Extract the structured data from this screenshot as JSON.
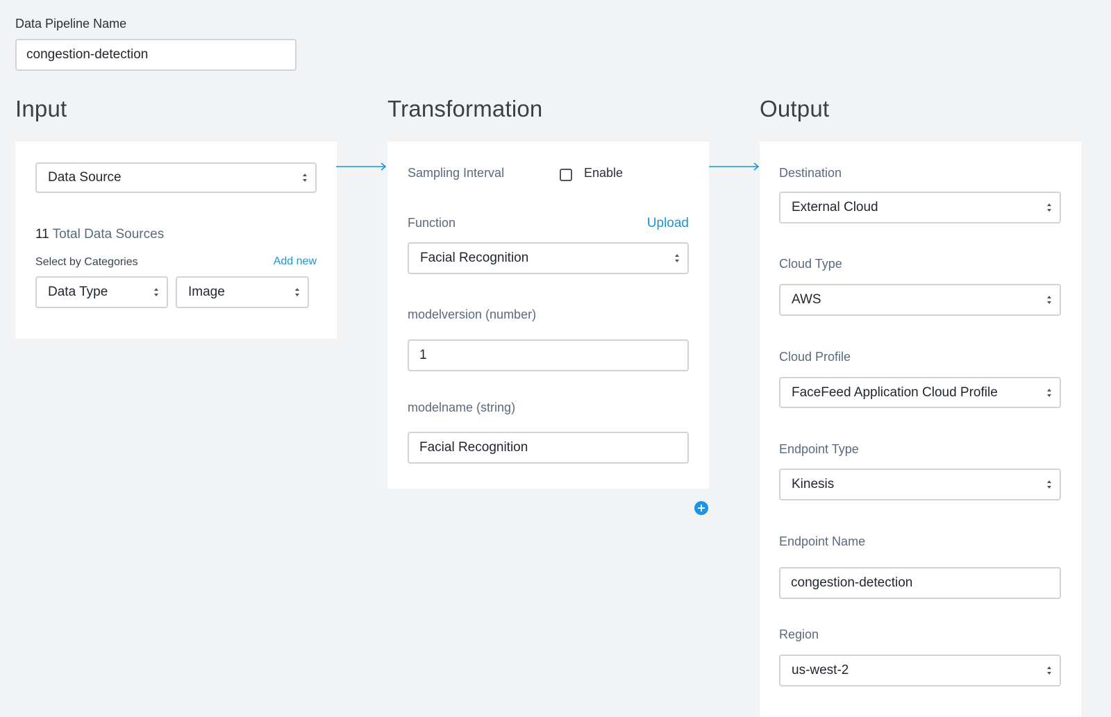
{
  "pipeline": {
    "name_label": "Data Pipeline Name",
    "name_value": "congestion-detection"
  },
  "input": {
    "title": "Input",
    "data_source_select": "Data Source",
    "total_count": "11",
    "total_label": "Total Data Sources",
    "categories_label": "Select by Categories",
    "add_new": "Add new",
    "category_key": "Data Type",
    "category_value": "Image"
  },
  "transformation": {
    "title": "Transformation",
    "sampling_label": "Sampling Interval",
    "enable_label": "Enable",
    "function_label": "Function",
    "upload": "Upload",
    "function_select": "Facial Recognition",
    "modelversion_label": "modelversion (number)",
    "modelversion_value": "1",
    "modelname_label": "modelname (string)",
    "modelname_value": "Facial Recognition"
  },
  "output": {
    "title": "Output",
    "destination_label": "Destination",
    "destination_value": "External Cloud",
    "cloud_type_label": "Cloud Type",
    "cloud_type_value": "AWS",
    "cloud_profile_label": "Cloud Profile",
    "cloud_profile_value": "FaceFeed Application Cloud Profile",
    "endpoint_type_label": "Endpoint Type",
    "endpoint_type_value": "Kinesis",
    "endpoint_name_label": "Endpoint Name",
    "endpoint_name_value": "congestion-detection",
    "region_label": "Region",
    "region_value": "us-west-2"
  },
  "icons": {
    "arrow": "arrow-right-icon",
    "caret": "select-caret-icon",
    "add": "plus-circle-icon",
    "checkbox": "checkbox-unchecked"
  },
  "colors": {
    "background": "#f2f3f5",
    "card": "#ffffff",
    "accent": "#1a94d9",
    "border": "#cfd4da"
  }
}
